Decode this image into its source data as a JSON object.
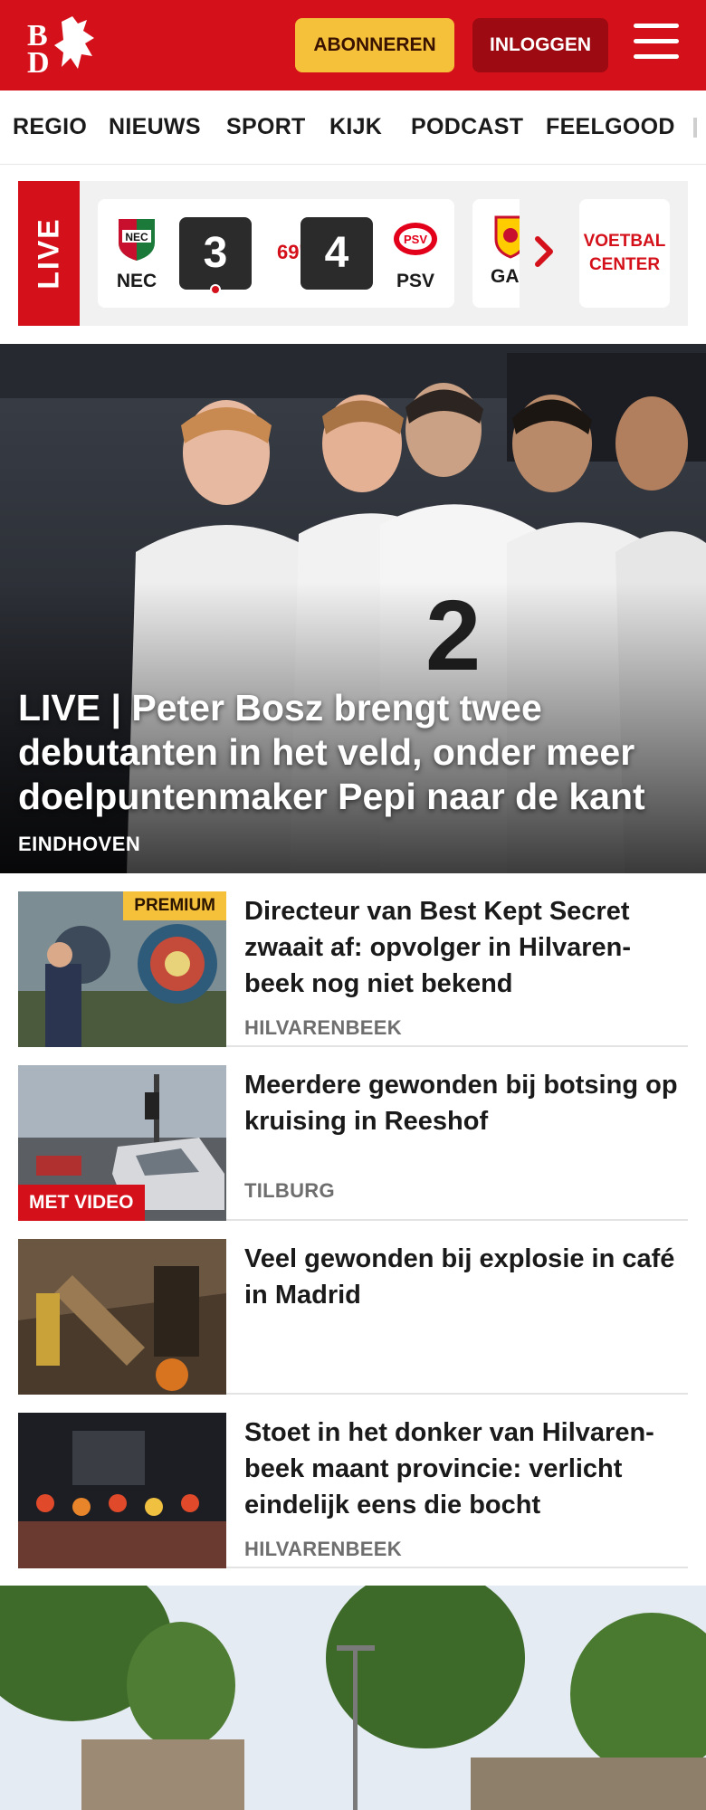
{
  "header": {
    "logo_text": "BD",
    "subscribe_label": "ABONNEREN",
    "login_label": "INLOGGEN",
    "brand_color": "#d4101a"
  },
  "nav": {
    "items": [
      "REGIO",
      "NIEUWS",
      "SPORT",
      "KIJK",
      "PODCAST",
      "FEELGOOD"
    ]
  },
  "live_bar": {
    "live_label": "LIVE",
    "match": {
      "home_team": "NEC",
      "home_score": "3",
      "minute": "69'",
      "away_team": "PSV",
      "away_score": "4"
    },
    "next_match_team": "GA",
    "voetbal_center_label": "VOETBAL CENTER"
  },
  "hero": {
    "title": "LIVE | Peter Bosz brengt twee debutanten in het veld, onder meer doelpuntenmaker Pepi naar de kant",
    "location": "EINDHOVEN"
  },
  "articles": [
    {
      "title": "Directeur van Best Kept Secret zwaait af: opvolger in Hilvaren-beek nog niet bekend",
      "location": "HILVARENBEEK",
      "badge": "PREMIUM"
    },
    {
      "title": "Meerdere gewonden bij botsing op kruising in Reeshof",
      "location": "TILBURG",
      "badge": "MET VIDEO"
    },
    {
      "title": "Veel gewonden bij explosie in café in Madrid",
      "location": ""
    },
    {
      "title": "Stoet in het donker van Hilvaren-beek maant provincie: verlicht eindelijk eens die bocht",
      "location": "HILVARENBEEK"
    }
  ],
  "icons": {
    "menu": "hamburger-icon",
    "scroll": "chevron-right-icon"
  }
}
